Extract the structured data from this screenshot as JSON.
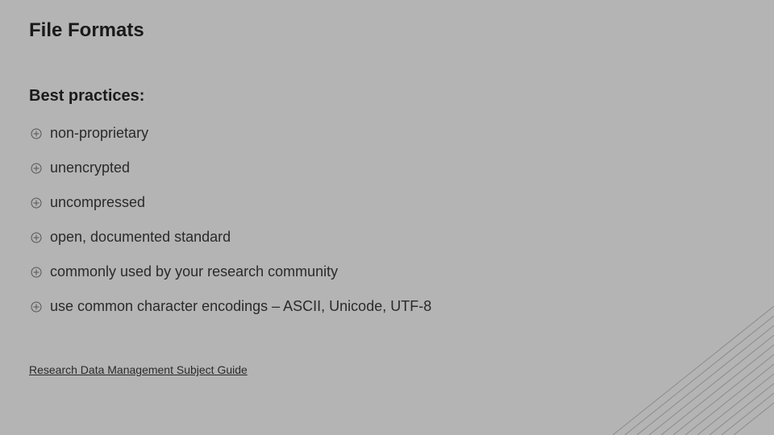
{
  "slide": {
    "title": "File Formats",
    "subtitle": "Best practices:",
    "bullets": [
      "non-proprietary",
      "unencrypted",
      "uncompressed",
      "open, documented standard",
      "commonly used by your research community",
      "use common character encodings – ASCII, Unicode, UTF-8"
    ],
    "link_text": "Research Data Management Subject Guide"
  }
}
